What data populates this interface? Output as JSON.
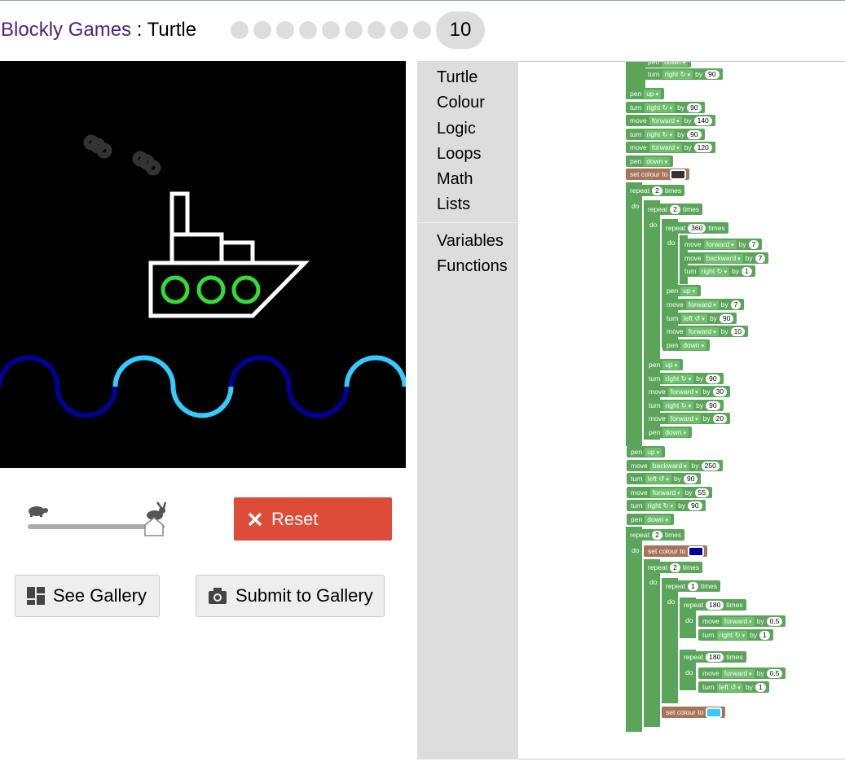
{
  "header": {
    "app": "Blockly Games",
    "sep": " : ",
    "game": "Turtle",
    "level": "10"
  },
  "controls": {
    "reset": "Reset",
    "see_gallery": "See Gallery",
    "submit_gallery": "Submit to Gallery",
    "speed_value": 0.92
  },
  "toolbox": [
    "Turtle",
    "Colour",
    "Logic",
    "Loops",
    "Math",
    "Lists",
    "Variables",
    "Functions"
  ],
  "blocks": {
    "pen_down": "down",
    "pen_up": "up",
    "right": "right ↻",
    "left": "left ↺",
    "forward": "forward",
    "backward": "backward",
    "set_colour": "set colour to",
    "repeat": "repeat",
    "times": "times",
    "by": "by",
    "do": "do",
    "turn": "turn",
    "move": "move",
    "pen": "pen"
  },
  "colors": {
    "loop": "#5ba55b",
    "colour_block": "#a5745b",
    "reset": "#dd4b39",
    "swatch_dark": "#333333",
    "swatch_navy": "#000099",
    "swatch_cyan": "#33ccff"
  }
}
